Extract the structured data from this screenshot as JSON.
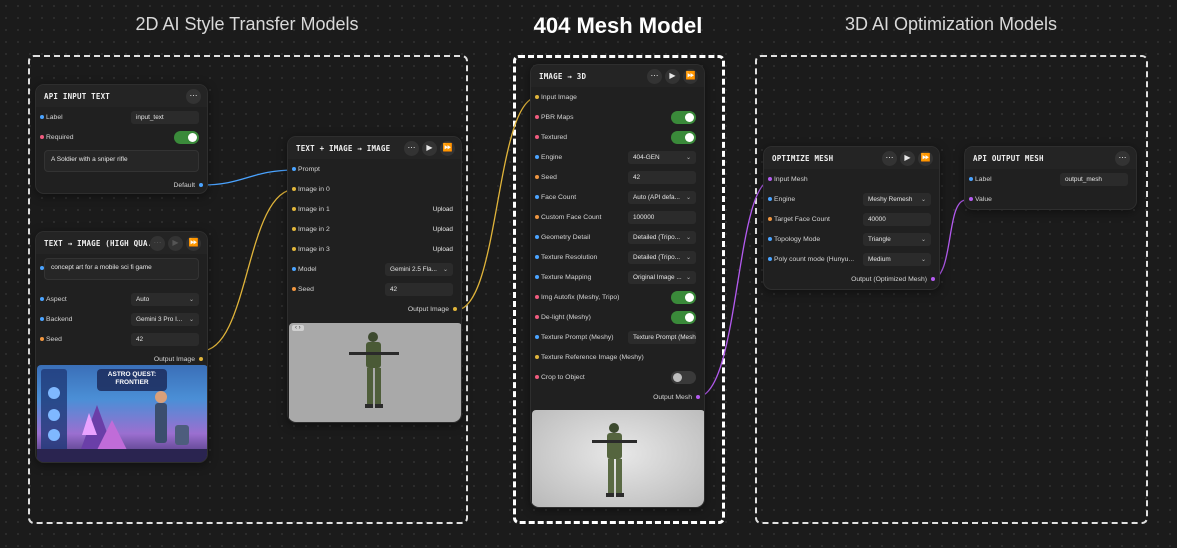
{
  "sections": {
    "left": "2D AI Style Transfer Models",
    "middle": "404 Mesh Model",
    "right": "3D AI Optimization Models"
  },
  "colors": {
    "background": "#1b1b1b",
    "node": "#202020",
    "toggle_on": "#3a8a3a",
    "port_string": "#4aa3ff",
    "port_bool": "#f05b7e",
    "port_number": "#f0953e",
    "port_image": "#e0b43a",
    "port_mesh": "#b45bf0"
  },
  "nodes": {
    "api_input_text": {
      "title": "API INPUT TEXT",
      "label_label": "Label",
      "label_value": "input_text",
      "required_label": "Required",
      "required_on": true,
      "text_value": "A Soldier with a sniper rifle",
      "output_label": "Default"
    },
    "text_to_image": {
      "title": "TEXT → IMAGE (HIGH QUA...",
      "prompt_value": "concept art for a mobile sci fi game",
      "aspect_label": "Aspect",
      "aspect_value": "Auto",
      "backend_label": "Backend",
      "backend_value": "Gemini 3 Pro I...",
      "seed_label": "Seed",
      "seed_value": "42",
      "output_label": "Output Image",
      "preview_title_line1": "ASTRO QUEST:",
      "preview_title_line2": "FRONTIER"
    },
    "text_image_image": {
      "title": "TEXT + IMAGE → IMAGE",
      "prompt_label": "Prompt",
      "image0_label": "Image in 0",
      "image1_label": "Image in 1",
      "image2_label": "Image in 2",
      "image3_label": "Image in 3",
      "upload_label": "Upload",
      "model_label": "Model",
      "model_value": "Gemini 2.5 Fla...",
      "seed_label": "Seed",
      "seed_value": "42",
      "output_label": "Output Image"
    },
    "image_to_3d": {
      "title": "IMAGE → 3D",
      "rows": [
        {
          "label": "Input Image",
          "port": "yellow",
          "kind": "none"
        },
        {
          "label": "PBR Maps",
          "port": "pink",
          "kind": "toggle",
          "on": true
        },
        {
          "label": "Textured",
          "port": "pink",
          "kind": "toggle",
          "on": true
        },
        {
          "label": "Engine",
          "port": "blue",
          "kind": "select",
          "value": "404-GEN"
        },
        {
          "label": "Seed",
          "port": "orange",
          "kind": "field",
          "value": "42"
        },
        {
          "label": "Face Count",
          "port": "blue",
          "kind": "select",
          "value": "Auto (API defa..."
        },
        {
          "label": "Custom Face Count",
          "port": "orange",
          "kind": "field",
          "value": "100000"
        },
        {
          "label": "Geometry Detail",
          "port": "blue",
          "kind": "select",
          "value": "Detailed (Tripo..."
        },
        {
          "label": "Texture Resolution",
          "port": "blue",
          "kind": "select",
          "value": "Detailed (Tripo..."
        },
        {
          "label": "Texture Mapping",
          "port": "blue",
          "kind": "select",
          "value": "Original Image ..."
        },
        {
          "label": "Img Autofix (Meshy, Tripo)",
          "port": "pink",
          "kind": "toggle",
          "on": true
        },
        {
          "label": "De-light (Meshy)",
          "port": "pink",
          "kind": "toggle",
          "on": true
        },
        {
          "label": "Texture Prompt (Meshy)",
          "port": "blue",
          "kind": "field",
          "value": "Texture Prompt (Mesh"
        },
        {
          "label": "Texture Reference Image (Meshy)",
          "port": "yellow",
          "kind": "none"
        },
        {
          "label": "Crop to Object",
          "port": "pink",
          "kind": "toggle",
          "on": false
        }
      ],
      "output_label": "Output Mesh"
    },
    "optimize_mesh": {
      "title": "OPTIMIZE MESH",
      "input_label": "Input Mesh",
      "engine_label": "Engine",
      "engine_value": "Meshy Remesh",
      "target_label": "Target Face Count",
      "target_value": "40000",
      "topology_label": "Topology Mode",
      "topology_value": "Triangle",
      "poly_label": "Poly count mode (Hunyu...",
      "poly_value": "Medium",
      "output_label": "Output (Optimized Mesh)"
    },
    "api_output_mesh": {
      "title": "API OUTPUT MESH",
      "label_label": "Label",
      "label_value": "output_mesh",
      "value_label": "Value"
    }
  }
}
